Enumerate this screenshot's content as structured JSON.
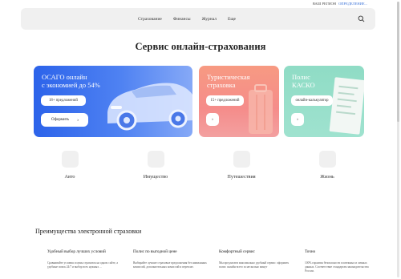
{
  "region": {
    "label": "ВАШ РЕГИОН",
    "value": "ОПРЕДЕЛЕНИЕ..."
  },
  "nav": {
    "links": [
      "Страхование",
      "Финансы",
      "Журнал",
      "Еще"
    ]
  },
  "hero": {
    "title": "Сервис онлайн-страхования"
  },
  "cards": {
    "osago": {
      "title_line1": "ОСАГО онлайн",
      "title_line2": "с экономией до 54%",
      "chip": "18+ предложений",
      "button": "Оформить",
      "arrow": "›"
    },
    "travel": {
      "title_line1": "Туристическая",
      "title_line2": "страховка",
      "chip": "15+ предложений",
      "arrow": "›"
    },
    "kasko": {
      "title_line1": "Полис",
      "title_line2": "КАСКО",
      "chip": "онлайн-калькулятор",
      "arrow": "›"
    }
  },
  "categories": [
    "Авто",
    "Имущество",
    "Путешествия",
    "Жизнь"
  ],
  "advantages": {
    "title": "Преимущества электронной страховки",
    "items": [
      {
        "heading": "Удобный выбор лучших условий",
        "text": "Сравнивайте условия и цены страховок на одном сайте, а удобные поиск 24/7 и выбор всех нужных ..."
      },
      {
        "heading": "Полис по выгодной цене",
        "text": "Выбирайте лучшие страховые предложения без навязанных комиссий, дополнительных комиссий и переплат."
      },
      {
        "heading": "Комфортный сервис",
        "text": "Мы предлагаем максимально удобный сервис: оформить полис онлайн всего за несколько минут"
      },
      {
        "heading": "Точно",
        "text": "100% гарантия безопасности платежных и личных данных. Соответствие стандартам законодательства России."
      }
    ]
  },
  "colors": {
    "osago_card": "#2c63ea",
    "travel_card": "#f58c8a",
    "kasko_card": "#8fdcc5",
    "nav_bg": "#f0f0f0",
    "region_value": "#3a72d8"
  }
}
